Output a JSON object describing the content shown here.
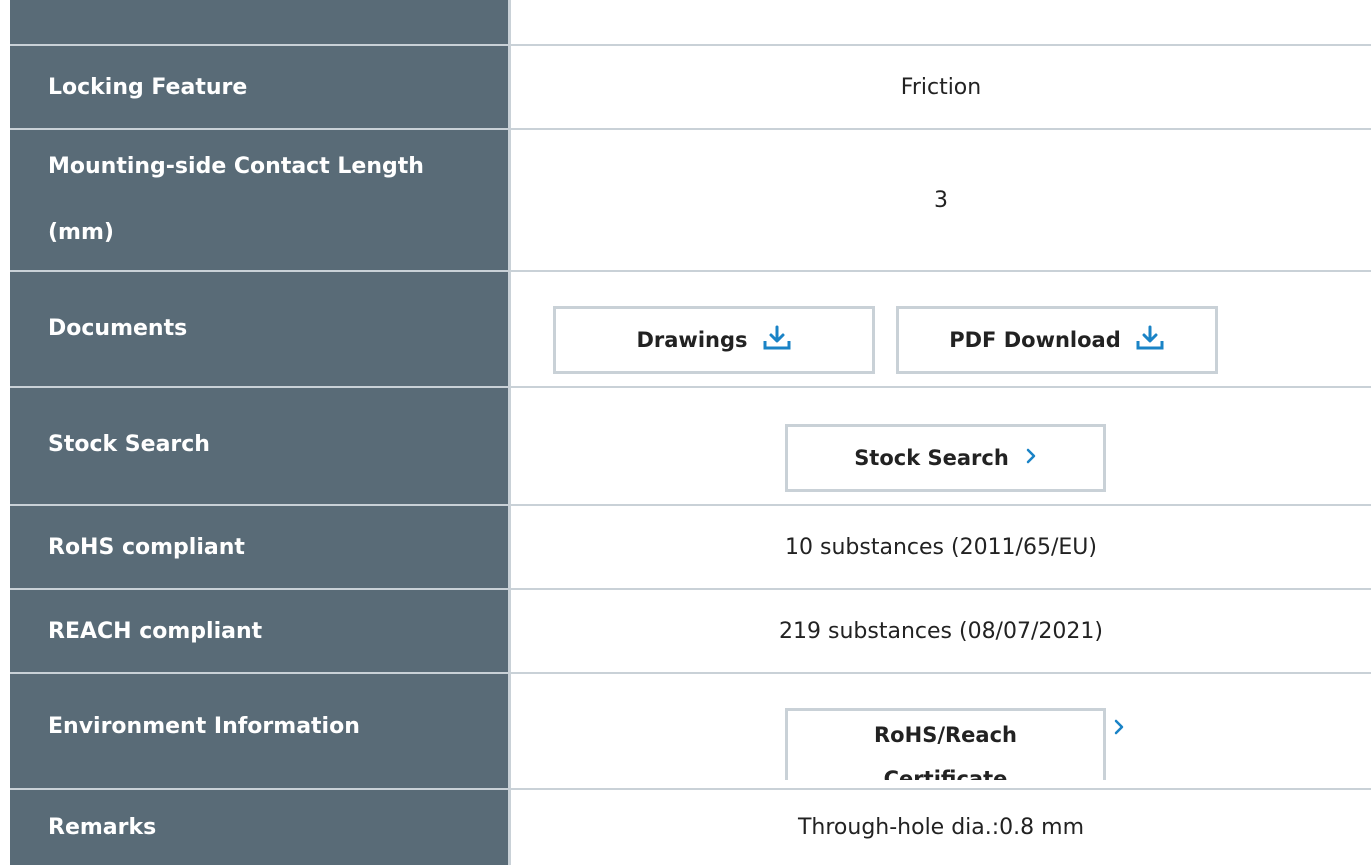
{
  "rows": {
    "locking": {
      "label": "Locking Feature",
      "value": "Friction"
    },
    "contact": {
      "label": "Mounting-side Contact Length (mm)",
      "value": "3"
    },
    "documents": {
      "label": "Documents",
      "drawings_label": "Drawings",
      "pdf_label": "PDF Download"
    },
    "stock": {
      "label": "Stock Search",
      "button_label": "Stock Search"
    },
    "rohs": {
      "label": "RoHS compliant",
      "value": "10 substances (2011/65/EU)"
    },
    "reach": {
      "label": "REACH compliant",
      "value": "219 substances (08/07/2021)"
    },
    "environment": {
      "label": "Environment Information",
      "button_line1": "RoHS/Reach",
      "button_line2": "Certificate"
    },
    "remarks": {
      "label": "Remarks",
      "value": "Through-hole dia.:0.8 mm"
    }
  },
  "colors": {
    "label_bg": "#596b77",
    "separator": "#c9d1d7",
    "accent": "#1a83c6"
  },
  "icons": {
    "download": "download-icon",
    "chevron": "chevron-right-icon"
  }
}
